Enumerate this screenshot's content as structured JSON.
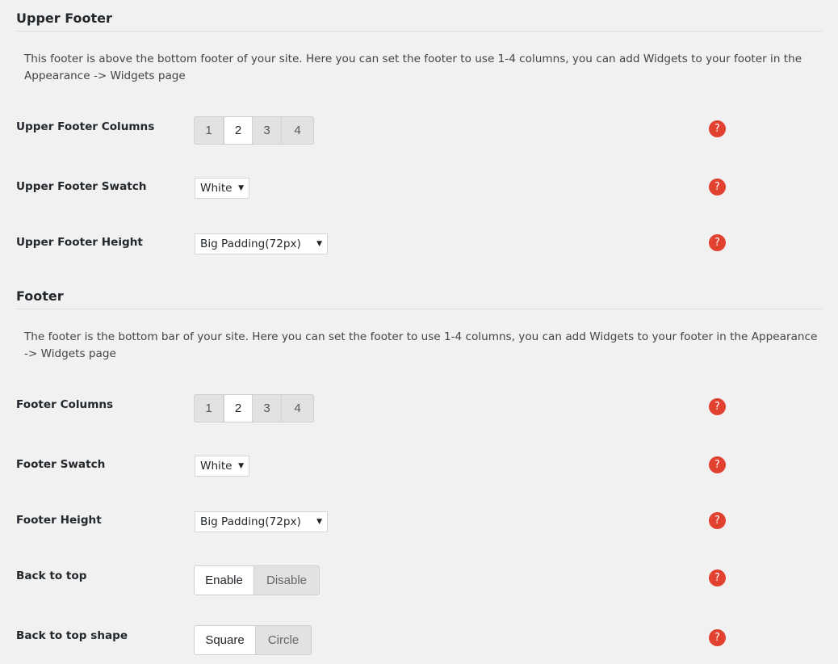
{
  "upper_footer": {
    "title": "Upper Footer",
    "description": "This footer is above the bottom footer of your site. Here you can set the footer to use 1-4 columns, you can add Widgets to your footer in the Appearance -> Widgets page",
    "columns": {
      "label": "Upper Footer Columns",
      "options": [
        "1",
        "2",
        "3",
        "4"
      ],
      "selected": "2"
    },
    "swatch": {
      "label": "Upper Footer Swatch",
      "value": "White"
    },
    "height": {
      "label": "Upper Footer Height",
      "value": "Big Padding(72px)"
    }
  },
  "footer": {
    "title": "Footer",
    "description": "The footer is the bottom bar of your site. Here you can set the footer to use 1-4 columns, you can add Widgets to your footer in the Appearance -> Widgets page",
    "columns": {
      "label": "Footer Columns",
      "options": [
        "1",
        "2",
        "3",
        "4"
      ],
      "selected": "2"
    },
    "swatch": {
      "label": "Footer Swatch",
      "value": "White"
    },
    "height": {
      "label": "Footer Height",
      "value": "Big Padding(72px)"
    },
    "back_to_top": {
      "label": "Back to top",
      "options": [
        "Enable",
        "Disable"
      ],
      "selected": "Enable"
    },
    "back_to_top_shape": {
      "label": "Back to top shape",
      "options": [
        "Square",
        "Circle"
      ],
      "selected": "Square"
    }
  },
  "icons": {
    "help": "question-mark-icon",
    "caret": "caret-down-icon",
    "help_glyph": "?",
    "caret_glyph": "▼"
  },
  "colors": {
    "help_icon": "#e2412f",
    "background": "#f1f1f1",
    "active_segment": "#ffffff",
    "inactive_segment": "#e2e2e2"
  }
}
